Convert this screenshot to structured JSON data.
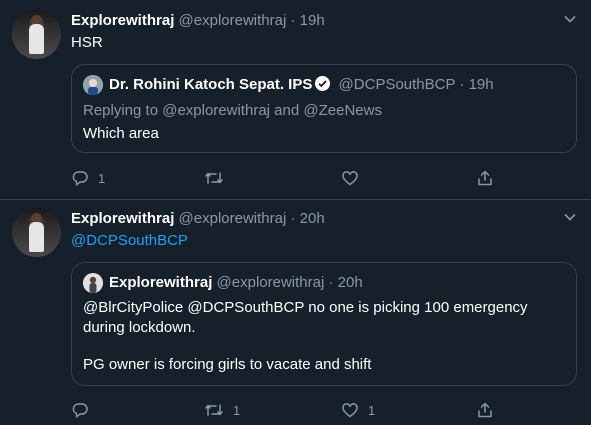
{
  "tweets": [
    {
      "name": "Explorewithraj",
      "handle": "@explorewithraj",
      "sep": "·",
      "time": "19h",
      "text": "HSR",
      "quote": {
        "name": "Dr. Rohini Katoch Sepat. IPS",
        "handle": "@DCPSouthBCP",
        "sep": "·",
        "time": "19h",
        "replying_prefix": "Replying to ",
        "replying_to": "@explorewithraj",
        "replying_and": " and ",
        "replying_to2": "@ZeeNews",
        "text": "Which area"
      },
      "actions": {
        "reply_count": "1",
        "retweet_count": "",
        "like_count": ""
      }
    },
    {
      "name": "Explorewithraj",
      "handle": "@explorewithraj",
      "sep": "·",
      "time": "20h",
      "text": "@DCPSouthBCP",
      "quote": {
        "name": "Explorewithraj",
        "handle": "@explorewithraj",
        "sep": "·",
        "time": "20h",
        "line1": "@BlrCityPolice @DCPSouthBCP no one is picking 100 emergency",
        "line2": "during lockdown.",
        "line3": "PG owner is forcing girls to vacate and shift"
      },
      "actions": {
        "reply_count": "",
        "retweet_count": "1",
        "like_count": "1"
      }
    }
  ],
  "icons": {
    "reply": "reply-icon",
    "retweet": "retweet-icon",
    "like": "heart-icon",
    "share": "share-icon",
    "caret": "chevron-down-icon",
    "verified": "verified-badge-icon"
  },
  "colors": {
    "background": "#15202b",
    "text": "#ffffff",
    "muted": "#8899a6",
    "accent": "#1da1f2",
    "border": "#38444d"
  }
}
